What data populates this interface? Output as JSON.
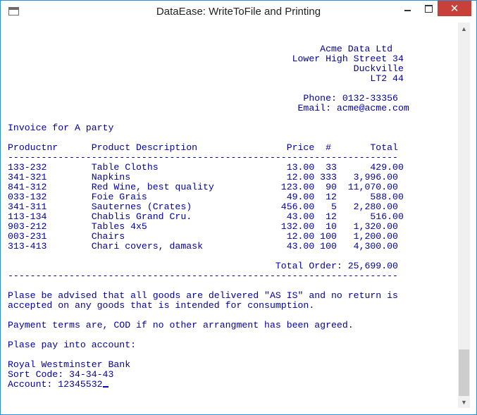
{
  "window": {
    "title": "DataEase: WriteToFile and Printing"
  },
  "icons": {
    "app": "console-window-icon",
    "minimize": "minimize-icon",
    "maximize": "maximize-icon",
    "close": "close-icon",
    "scroll_up": "scroll-up-arrow-icon",
    "scroll_down": "scroll-down-arrow-icon"
  },
  "colors": {
    "text": "#0000a8",
    "close_button": "#c7403a",
    "window_border": "#2b8fd8"
  },
  "console": {
    "lines": [
      "",
      "",
      "                                                        Acme Data Ltd",
      "                                                   Lower High Street 34",
      "                                                              Duckville",
      "                                                                 LT2 44",
      "",
      "                                                     Phone: 0132-33356",
      "                                                    Email: acme@acme.com",
      "",
      "Invoice for A party",
      "",
      "Productnr      Product Description                Price  #       Total",
      "----------------------------------------------------------------------",
      "133-232        Table Cloths                       13.00  33      429.00",
      "341-321        Napkins                            12.00 333   3,996.00",
      "841-312        Red Wine, best quality            123.00  90  11,070.00",
      "033-132        Foie Grais                         49.00  12      588.00",
      "341-311        Sauternes (Crates)                456.00   5   2,280.00",
      "113-134        Chablis Grand Cru.                 43.00  12      516.00",
      "903-212        Tables 4x5                        132.00  10   1,320.00",
      "003-231        Chairs                             12.00 100   1,200.00",
      "313-413        Chari covers, damask               43.00 100   4,300.00",
      "",
      "                                                Total Order: 25,699.00",
      "----------------------------------------------------------------------",
      "",
      "Plase be advised that all goods are delivered \"AS IS\" and no return is",
      "accepted on any goods that is intended for consumption.",
      "",
      "Payment terms are, COD if no other arrangment has been agreed.",
      "",
      "Plase pay into account:",
      "",
      "Royal Westminster Bank",
      "Sort Code: 34-34-43",
      "Account: 12345532"
    ]
  }
}
